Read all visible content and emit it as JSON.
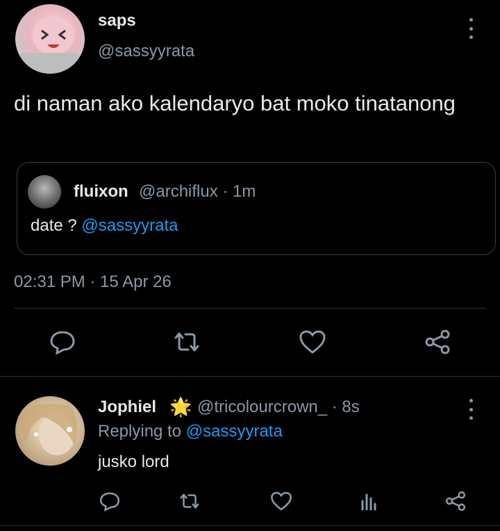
{
  "tweet": {
    "display_name": "saps",
    "handle": "@sassyyrata",
    "text": "di naman ako kalendaryo bat moko tinatanong",
    "timestamp": "02:31 PM · 15 Apr 26"
  },
  "quote": {
    "display_name": "fluixon",
    "meta": "@archiflux · 1m",
    "text_prefix": "date ? ",
    "mention": "@sassyyrata"
  },
  "actions": {
    "icons": [
      "reply-icon",
      "retweet-icon",
      "like-icon",
      "share-icon"
    ]
  },
  "reply": {
    "display_name": "Jophiel",
    "badge": "🌟",
    "meta": "@tricolourcrown_ · 8s",
    "replying_prefix": "Replying to ",
    "replying_to": "@sassyyrata",
    "text": "jusko lord",
    "icons": [
      "reply-icon",
      "retweet-icon",
      "like-icon",
      "analytics-icon",
      "share-icon"
    ]
  },
  "colors": {
    "background": "#000000",
    "text": "#e7e9ea",
    "secondary": "#8b98a5",
    "link": "#1d9bf0",
    "divider": "#2f3336"
  }
}
